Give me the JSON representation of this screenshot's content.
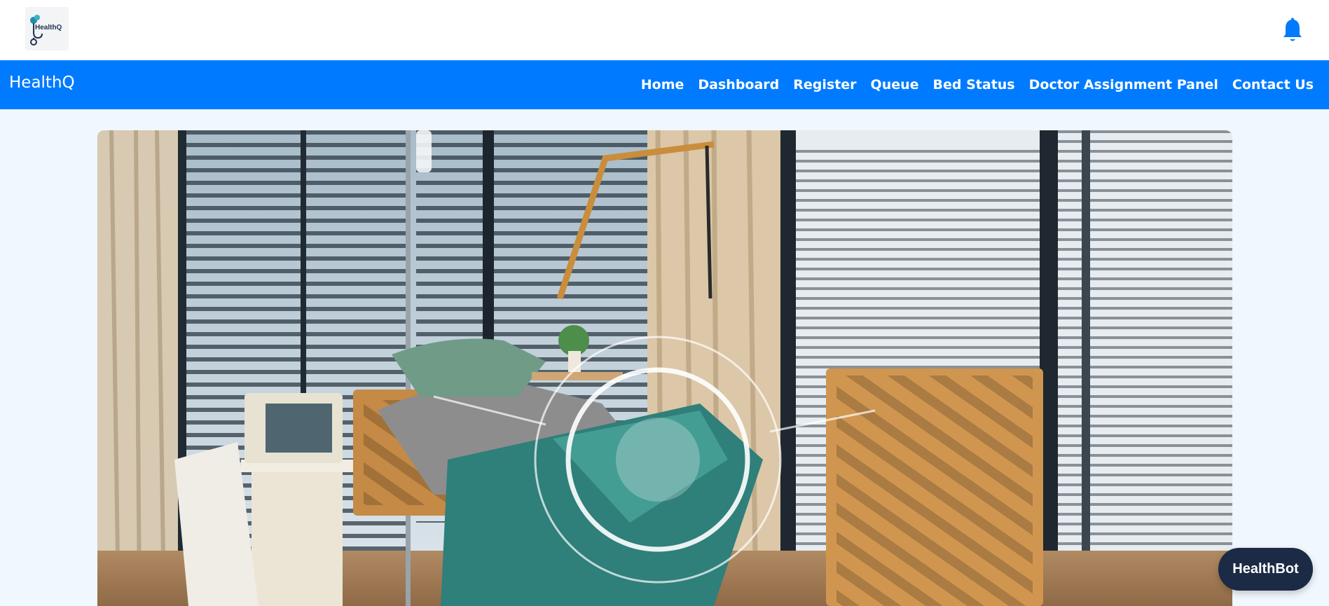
{
  "header": {
    "logo_text": "HealthQ",
    "notification_icon": "bell-icon",
    "accent_color": "#007bff"
  },
  "navbar": {
    "brand": "HealthQ",
    "links": [
      {
        "label": "Home"
      },
      {
        "label": "Dashboard"
      },
      {
        "label": "Register"
      },
      {
        "label": "Queue"
      },
      {
        "label": "Bed Status"
      },
      {
        "label": "Doctor Assignment Panel"
      },
      {
        "label": "Contact Us"
      }
    ],
    "background": "#007bff"
  },
  "hero": {
    "image": "hospital-room-photo"
  },
  "chatbot": {
    "label": "HealthBot",
    "background": "#1b2a45"
  }
}
